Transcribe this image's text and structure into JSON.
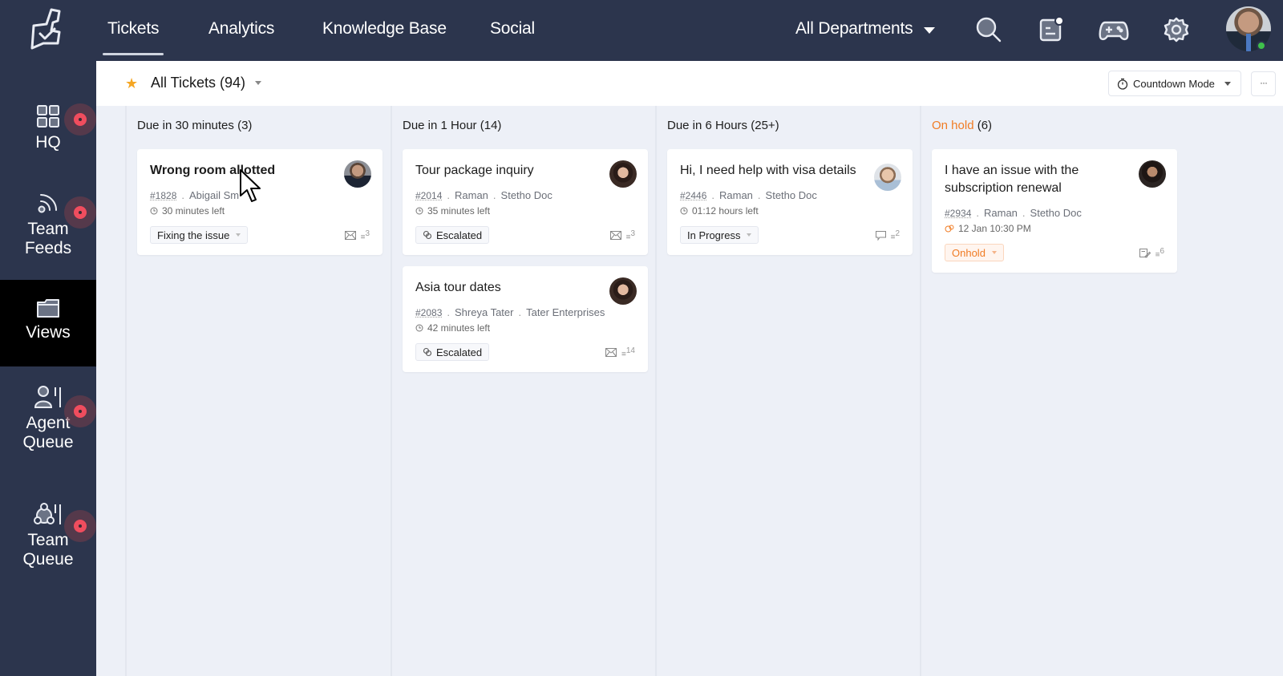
{
  "topbar": {
    "logo": "desk-logo-icon",
    "tabs": [
      {
        "label": "Tickets",
        "active": true
      },
      {
        "label": "Analytics",
        "active": false
      },
      {
        "label": "Knowledge Base",
        "active": false
      },
      {
        "label": "Social",
        "active": false
      }
    ],
    "department": "All Departments",
    "icons": [
      "search-icon",
      "notifications-icon",
      "gamification-icon",
      "settings-icon"
    ],
    "user_status": "online",
    "online_color": "#3fc14b"
  },
  "sidebar": {
    "items": [
      {
        "line1": "HQ",
        "line2": "",
        "icon": "grid-icon",
        "badge": true,
        "active": false
      },
      {
        "line1": "Team",
        "line2": "Feeds",
        "icon": "feed-icon",
        "badge": true,
        "active": false
      },
      {
        "line1": "Views",
        "line2": "",
        "icon": "folder-icon",
        "badge": false,
        "active": true
      },
      {
        "line1": "Agent",
        "line2": "Queue",
        "icon": "agent-queue-icon",
        "badge": true,
        "active": false
      },
      {
        "line1": "Team",
        "line2": "Queue",
        "icon": "team-queue-icon",
        "badge": true,
        "active": false
      }
    ],
    "badge_color": "#f04d5e"
  },
  "subheader": {
    "view_title": "All Tickets (94)",
    "countdown_label": "Countdown Mode",
    "more_label": "···",
    "star_color": "#f5a623"
  },
  "columns": [
    {
      "title": "Due in 30 minutes",
      "count": "(3)",
      "cards": [
        {
          "title": "Wrong room allotted",
          "id": "#1828",
          "contact": "Abigail Sm",
          "account": "",
          "time": "30 minutes left",
          "status": "Fixing the issue",
          "status_icon": "",
          "channel": "email-icon",
          "threads": "3"
        }
      ]
    },
    {
      "title": "Due in 1 Hour",
      "count": " (14)",
      "cards": [
        {
          "title": "Tour package inquiry",
          "id": "#2014",
          "contact": "Raman",
          "account": "Stetho Doc",
          "time": "35 minutes left",
          "status": "Escalated",
          "status_icon": "escalated-icon",
          "channel": "email-icon",
          "threads": "3"
        },
        {
          "title": "Asia tour dates",
          "id": "#2083",
          "contact": "Shreya Tater",
          "account": "Tater Enterprises",
          "time": "42 minutes left",
          "status": "Escalated",
          "status_icon": "escalated-icon",
          "channel": "email-icon",
          "threads": "14"
        }
      ]
    },
    {
      "title": "Due in 6 Hours",
      "count": "(25+)",
      "cards": [
        {
          "title": "Hi, I need help with visa details",
          "id": "#2446",
          "contact": "Raman",
          "account": "Stetho Doc",
          "time": "01:12 hours left",
          "status": "In Progress",
          "status_icon": "",
          "channel": "chat-icon",
          "threads": "2"
        }
      ]
    },
    {
      "title": "On hold",
      "count": " (6)",
      "title_color": "#f07c24",
      "cards": [
        {
          "title": "I have an issue with the subscription renewal",
          "id": "#2934",
          "contact": "Raman",
          "account": "Stetho Doc",
          "time": "12 Jan 10:30 PM",
          "status": "Onhold",
          "status_icon": "",
          "channel": "web-form-icon",
          "threads": "6"
        }
      ]
    }
  ]
}
